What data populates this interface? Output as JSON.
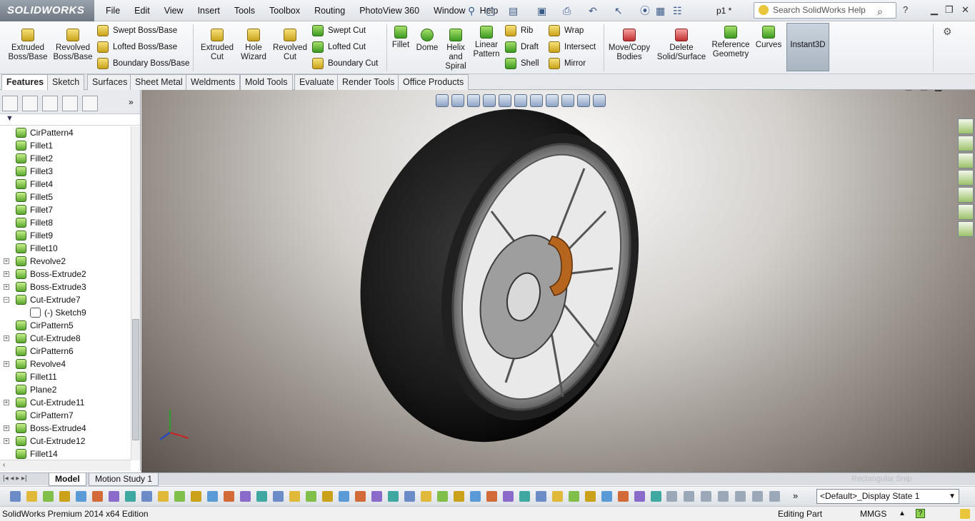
{
  "app": {
    "logo": "SOLIDWORKS",
    "doc_name": "p1 *"
  },
  "menu": [
    "File",
    "Edit",
    "View",
    "Insert",
    "Tools",
    "Toolbox",
    "Routing",
    "PhotoView 360",
    "Window",
    "Help"
  ],
  "help_search": {
    "placeholder": "Search SolidWorks Help"
  },
  "ribbon": {
    "extruded_boss": "Extruded Boss/Base",
    "revolved_boss": "Revolved Boss/Base",
    "swept_boss": "Swept Boss/Base",
    "lofted_boss": "Lofted Boss/Base",
    "boundary_boss": "Boundary Boss/Base",
    "extruded_cut": "Extruded Cut",
    "hole_wizard": "Hole Wizard",
    "revolved_cut": "Revolved Cut",
    "swept_cut": "Swept Cut",
    "lofted_cut": "Lofted Cut",
    "boundary_cut": "Boundary Cut",
    "fillet": "Fillet",
    "dome": "Dome",
    "helix": "Helix and Spiral",
    "linear_pattern": "Linear Pattern",
    "rib": "Rib",
    "draft": "Draft",
    "shell": "Shell",
    "wrap": "Wrap",
    "intersect": "Intersect",
    "mirror": "Mirror",
    "move_copy": "Move/Copy Bodies",
    "delete_solid": "Delete Solid/Surface",
    "ref_geometry": "Reference Geometry",
    "curves": "Curves",
    "instant3d": "Instant3D"
  },
  "tabs": [
    "Features",
    "Sketch",
    "Surfaces",
    "Sheet Metal",
    "Weldments",
    "Mold Tools",
    "Evaluate",
    "Render Tools",
    "Office Products"
  ],
  "tree": [
    {
      "label": "CirPattern4",
      "exp": false
    },
    {
      "label": "Fillet1",
      "exp": false
    },
    {
      "label": "Fillet2",
      "exp": false
    },
    {
      "label": "Fillet3",
      "exp": false
    },
    {
      "label": "Fillet4",
      "exp": false
    },
    {
      "label": "Fillet5",
      "exp": false
    },
    {
      "label": "Fillet7",
      "exp": false
    },
    {
      "label": "Fillet8",
      "exp": false
    },
    {
      "label": "Fillet9",
      "exp": false
    },
    {
      "label": "Fillet10",
      "exp": false
    },
    {
      "label": "Revolve2",
      "exp": true
    },
    {
      "label": "Boss-Extrude2",
      "exp": true
    },
    {
      "label": "Boss-Extrude3",
      "exp": true
    },
    {
      "label": "Cut-Extrude7",
      "exp": true,
      "open": true
    },
    {
      "label": "(-) Sketch9",
      "child": true
    },
    {
      "label": "CirPattern5",
      "exp": false
    },
    {
      "label": "Cut-Extrude8",
      "exp": true
    },
    {
      "label": "CirPattern6",
      "exp": false
    },
    {
      "label": "Revolve4",
      "exp": true
    },
    {
      "label": "Fillet11",
      "exp": false
    },
    {
      "label": "Plane2",
      "exp": false
    },
    {
      "label": "Cut-Extrude11",
      "exp": true
    },
    {
      "label": "CirPattern7",
      "exp": false
    },
    {
      "label": "Boss-Extrude4",
      "exp": true
    },
    {
      "label": "Cut-Extrude12",
      "exp": true
    },
    {
      "label": "Fillet14",
      "exp": false
    }
  ],
  "bottom_tabs": [
    "Model",
    "Motion Study 1"
  ],
  "hint": "Rectangular Snip",
  "display_state": "<Default>_Display State 1",
  "status": {
    "edition": "SolidWorks Premium 2014 x64 Edition",
    "mode": "Editing Part",
    "units": "MMGS"
  }
}
